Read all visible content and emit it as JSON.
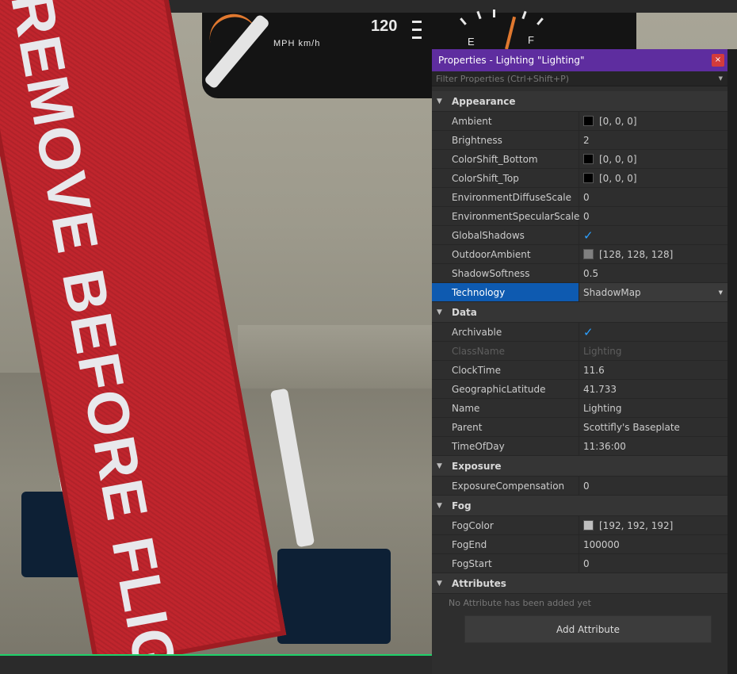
{
  "viewport": {
    "tag_text": "REMOVE BEFORE FLIGHT",
    "gauge_mph": "MPH km/h",
    "gauge_speed": "120",
    "gauge_empty": "E",
    "gauge_full": "F"
  },
  "panel": {
    "title": "Properties - Lighting \"Lighting\"",
    "close_glyph": "×",
    "filter_placeholder": "Filter Properties (Ctrl+Shift+P)",
    "categories": {
      "appearance": "Appearance",
      "data": "Data",
      "exposure": "Exposure",
      "fog": "Fog",
      "attributes": "Attributes"
    },
    "appearance": [
      {
        "name": "Ambient",
        "value": "[0, 0, 0]",
        "color": "#000000"
      },
      {
        "name": "Brightness",
        "value": "2"
      },
      {
        "name": "ColorShift_Bottom",
        "value": "[0, 0, 0]",
        "color": "#000000"
      },
      {
        "name": "ColorShift_Top",
        "value": "[0, 0, 0]",
        "color": "#000000"
      },
      {
        "name": "EnvironmentDiffuseScale",
        "value": "0"
      },
      {
        "name": "EnvironmentSpecularScale",
        "value": "0"
      },
      {
        "name": "GlobalShadows",
        "value": "✓",
        "checked": true
      },
      {
        "name": "OutdoorAmbient",
        "value": "[128, 128, 128]",
        "color": "#808080"
      },
      {
        "name": "ShadowSoftness",
        "value": "0.5"
      },
      {
        "name": "Technology",
        "value": "ShadowMap",
        "selected": true
      }
    ],
    "data": [
      {
        "name": "Archivable",
        "value": "✓",
        "checked": true
      },
      {
        "name": "ClassName",
        "value": "Lighting",
        "readonly": true
      },
      {
        "name": "ClockTime",
        "value": "11.6"
      },
      {
        "name": "GeographicLatitude",
        "value": "41.733"
      },
      {
        "name": "Name",
        "value": "Lighting"
      },
      {
        "name": "Parent",
        "value": "Scottifly's Baseplate"
      },
      {
        "name": "TimeOfDay",
        "value": "11:36:00"
      }
    ],
    "exposure": [
      {
        "name": "ExposureCompensation",
        "value": "0"
      }
    ],
    "fog": [
      {
        "name": "FogColor",
        "value": "[192, 192, 192]",
        "color": "#c0c0c0"
      },
      {
        "name": "FogEnd",
        "value": "100000"
      },
      {
        "name": "FogStart",
        "value": "0"
      }
    ],
    "attributes_empty": "No Attribute has been added yet",
    "add_attribute_label": "Add Attribute",
    "chevron": "▼",
    "dropdown_arrow": "▼"
  },
  "colors": {
    "title_bar": "#5e2d9f",
    "selection": "#0e5ab0",
    "checkmark": "#2ca0ff",
    "status_line": "#1fd16a"
  }
}
